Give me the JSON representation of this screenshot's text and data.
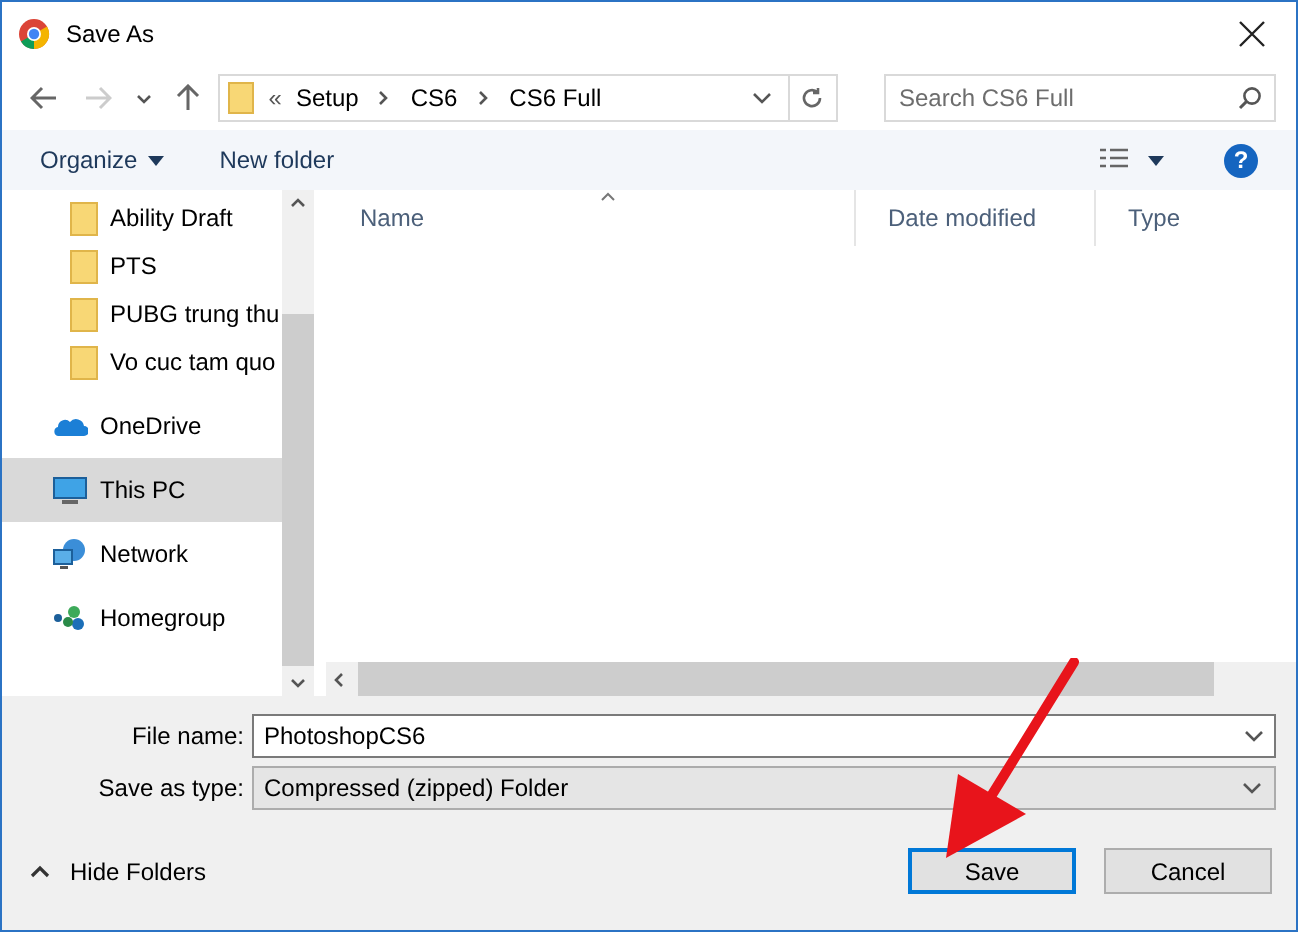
{
  "window": {
    "title": "Save As"
  },
  "address_bar": {
    "overflow": "«",
    "crumbs": [
      "Setup",
      "CS6",
      "CS6 Full"
    ]
  },
  "search": {
    "placeholder": "Search CS6 Full"
  },
  "toolbar": {
    "organize": "Organize",
    "new_folder": "New folder",
    "help": "?"
  },
  "sidebar": {
    "items": [
      {
        "label": "Ability Draft",
        "kind": "folder",
        "selected": false
      },
      {
        "label": "PTS",
        "kind": "folder",
        "selected": false
      },
      {
        "label": "PUBG trung thu",
        "kind": "folder",
        "selected": false
      },
      {
        "label": "Vo cuc tam quo",
        "kind": "folder",
        "selected": false
      },
      {
        "label": "OneDrive",
        "kind": "cloud",
        "selected": false
      },
      {
        "label": "This PC",
        "kind": "pc",
        "selected": true
      },
      {
        "label": "Network",
        "kind": "network",
        "selected": false
      },
      {
        "label": "Homegroup",
        "kind": "homegroup",
        "selected": false
      }
    ]
  },
  "table": {
    "columns": [
      "Name",
      "Date modified",
      "Type"
    ]
  },
  "form": {
    "file_name_label": "File name:",
    "file_name": "PhotoshopCS6",
    "type_label": "Save as type:",
    "type": "Compressed (zipped) Folder"
  },
  "hide_folders": "Hide Folders",
  "buttons": [
    {
      "label": "Save",
      "kind": "primary"
    },
    {
      "label": "Cancel",
      "kind": "normal"
    }
  ]
}
